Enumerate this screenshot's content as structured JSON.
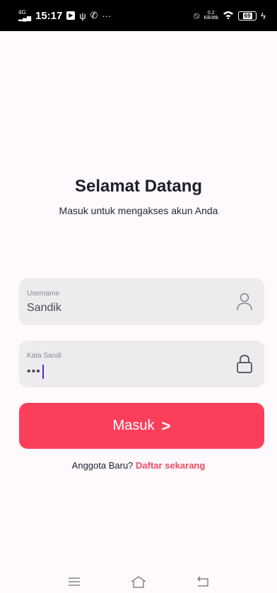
{
  "status_bar": {
    "network": "4G",
    "time": "15:17",
    "notif_icons": [
      "media-icon",
      "usb-icon",
      "whatsapp-icon",
      "more-icon"
    ],
    "more": "···",
    "speed_value": "0.2",
    "speed_unit": "KB/dtk",
    "battery": "69",
    "charging": "+"
  },
  "header": {
    "title": "Selamat Datang",
    "subtitle": "Masuk untuk mengakses akun Anda"
  },
  "form": {
    "username_label": "Username",
    "username_value": "Sandik",
    "password_label": "Kata Sandi",
    "password_value": "•••"
  },
  "login_button": {
    "label": "Masuk",
    "chevron": ">"
  },
  "register": {
    "prompt": "Anggota Baru?",
    "link": "Daftar sekarang"
  },
  "colors": {
    "background": "#fdf9fc",
    "accent": "#fb3f5a",
    "field_bg": "#eeebef",
    "link": "#f24b63"
  }
}
